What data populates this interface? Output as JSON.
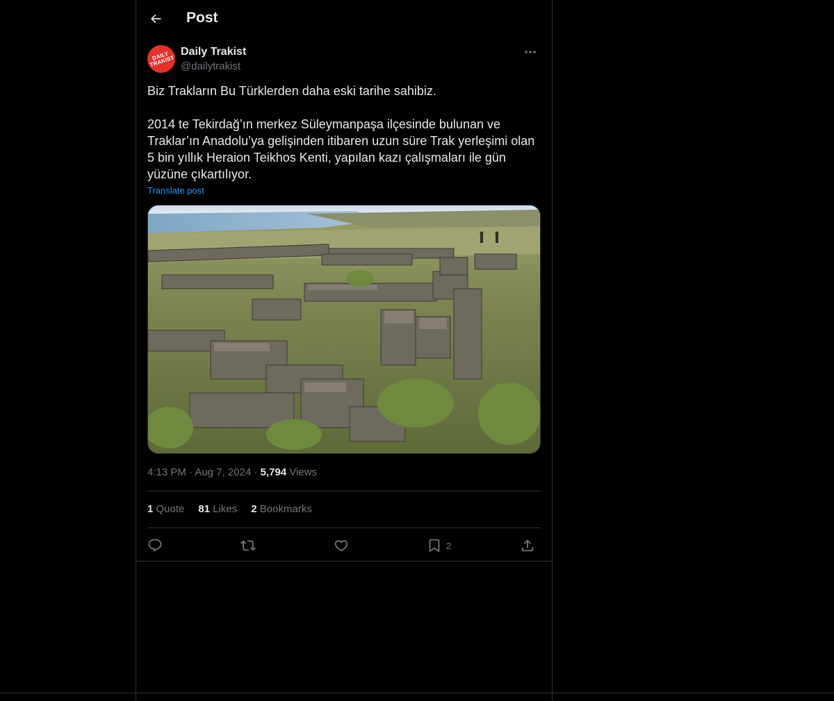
{
  "header": {
    "title": "Post",
    "back_icon": "arrow-left-icon"
  },
  "post": {
    "author": {
      "display_name": "Daily Trakist",
      "handle": "@dailytrakist",
      "avatar_text": "DAILY TRAKIST",
      "avatar_color": "#e4312b"
    },
    "text": "Biz Trakların Bu Türklerden daha eski tarihe sahibiz.\n\n2014 te Tekirdağ’ın merkez Süleymanpaşa ilçesinde bulunan ve Traklar’ın Anadolu’ya gelişinden itibaren uzun süre Trak yerleşimi olan 5 bin yıllık Heraion Teikhos Kenti, yapılan kazı çalışmaları ile gün yüzüne çıkartılıyor.",
    "translate_label": "Translate post",
    "time": "4:13 PM",
    "date": "Aug 7, 2024",
    "views_count": "5,794",
    "views_label": "Views",
    "separator": "·"
  },
  "stats": {
    "quotes": {
      "count": "1",
      "label": "Quote"
    },
    "likes": {
      "count": "81",
      "label": "Likes"
    },
    "bookmarks": {
      "count": "2",
      "label": "Bookmarks"
    }
  },
  "actions": {
    "reply": {
      "icon": "reply-icon"
    },
    "repost": {
      "icon": "repost-icon"
    },
    "like": {
      "icon": "heart-icon"
    },
    "bookmark": {
      "icon": "bookmark-icon",
      "count": "2"
    },
    "share": {
      "icon": "share-icon"
    }
  },
  "colors": {
    "background": "#000000",
    "text": "#e7e9ea",
    "secondary": "#71767b",
    "link": "#1d9bf0",
    "border": "#2f3336"
  }
}
